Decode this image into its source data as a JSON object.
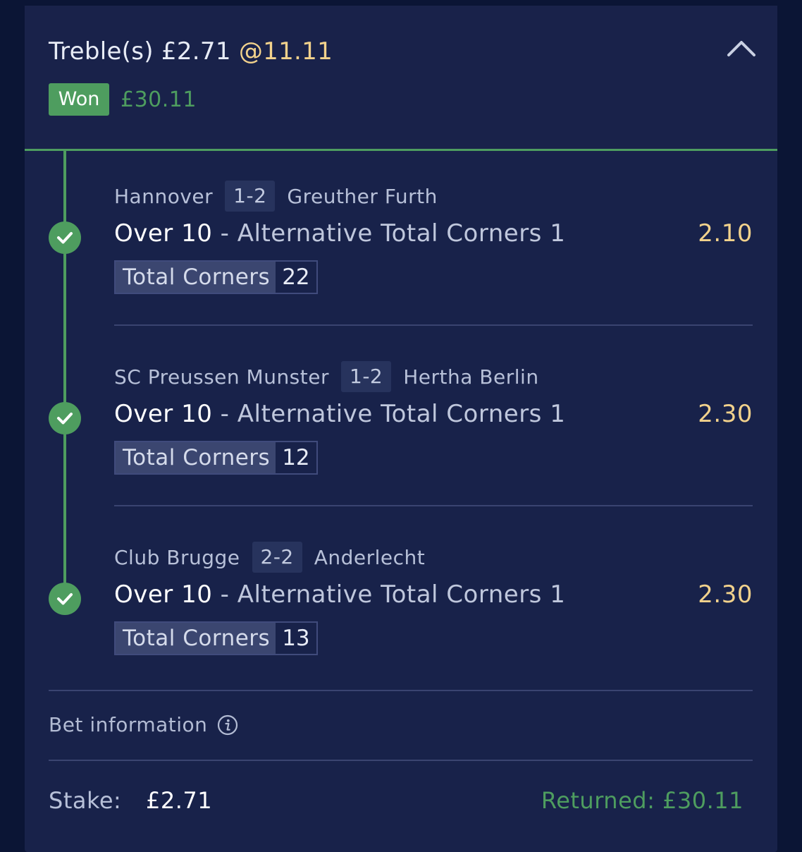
{
  "bet": {
    "type": "Treble(s)",
    "stake": "£2.71",
    "odds": "@11.11",
    "status": "Won",
    "won_amount": "£30.11"
  },
  "colors": {
    "won_green": "#4e9d5f",
    "odds_gold": "#f2d28c",
    "panel_bg": "#18224a",
    "page_bg": "#0b1535"
  },
  "icons": {
    "collapse": "chevron-up-icon",
    "settled": "check-circle-icon",
    "info": "info-icon"
  },
  "legs": [
    {
      "home": "Hannover",
      "score": "1-2",
      "away": "Greuther Furth",
      "selection": "Over 10",
      "market": "- Alternative Total Corners 1",
      "odds": "2.10",
      "stat_label": "Total Corners",
      "stat_value": "22"
    },
    {
      "home": "SC Preussen Munster",
      "score": "1-2",
      "away": "Hertha Berlin",
      "selection": "Over 10",
      "market": "- Alternative Total Corners 1",
      "odds": "2.30",
      "stat_label": "Total Corners",
      "stat_value": "12"
    },
    {
      "home": "Club Brugge",
      "score": "2-2",
      "away": "Anderlecht",
      "selection": "Over 10",
      "market": "- Alternative Total Corners 1",
      "odds": "2.30",
      "stat_label": "Total Corners",
      "stat_value": "13"
    }
  ],
  "footer": {
    "bet_info_label": "Bet information",
    "stake_label": "Stake:",
    "stake_value": "£2.71",
    "returned_label": "Returned:",
    "returned_value": "£30.11"
  }
}
